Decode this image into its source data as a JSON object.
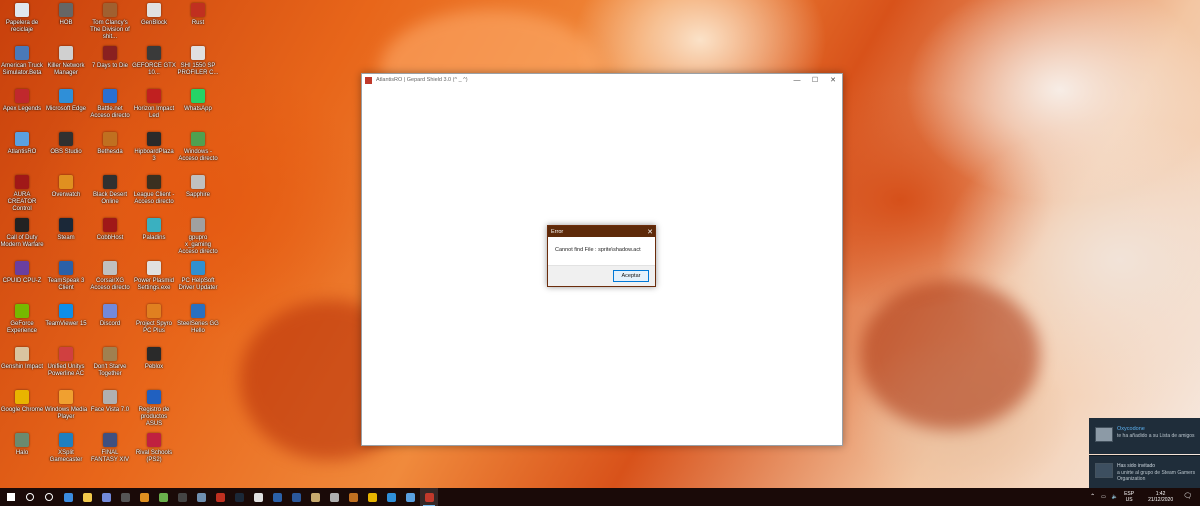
{
  "desktop_icons": [
    {
      "label": "Papelera de reciclaje",
      "color": "#dfe7ef",
      "col": 0,
      "row": 0
    },
    {
      "label": "American Truck Simulator.Beta",
      "color": "#4a79b8",
      "col": 0,
      "row": 1
    },
    {
      "label": "Apex Legends",
      "color": "#c0282d",
      "col": 0,
      "row": 2
    },
    {
      "label": "AtlantisRO",
      "color": "#5aa0e0",
      "col": 0,
      "row": 3
    },
    {
      "label": "AURA CREATOR Control",
      "color": "#a01818",
      "col": 0,
      "row": 4
    },
    {
      "label": "Call of Duty Modern Warfare",
      "color": "#222222",
      "col": 0,
      "row": 5
    },
    {
      "label": "CPUID CPU-Z",
      "color": "#6a3fa0",
      "col": 0,
      "row": 6
    },
    {
      "label": "GeForce Experience",
      "color": "#76b900",
      "col": 0,
      "row": 7
    },
    {
      "label": "Genshin Impact",
      "color": "#d9c4a0",
      "col": 0,
      "row": 8
    },
    {
      "label": "Google Chrome",
      "color": "#e8b400",
      "col": 0,
      "row": 9
    },
    {
      "label": "Halo",
      "color": "#6b8a6f",
      "col": 0,
      "row": 10
    },
    {
      "label": "HOB",
      "color": "#666666",
      "col": 1,
      "row": 0
    },
    {
      "label": "Killer Network Manager",
      "color": "#d0d0d0",
      "col": 1,
      "row": 1
    },
    {
      "label": "Microsoft Edge",
      "color": "#2f8fd8",
      "col": 1,
      "row": 2
    },
    {
      "label": "OBS Studio",
      "color": "#303030",
      "col": 1,
      "row": 3
    },
    {
      "label": "Overwatch",
      "color": "#e09020",
      "col": 1,
      "row": 4
    },
    {
      "label": "Steam",
      "color": "#1b2838",
      "col": 1,
      "row": 5
    },
    {
      "label": "TeamSpeak 3 Client",
      "color": "#2b60a8",
      "col": 1,
      "row": 6
    },
    {
      "label": "TeamViewer 15",
      "color": "#0e8ee9",
      "col": 1,
      "row": 7
    },
    {
      "label": "Unified Unitys Powerline AC",
      "color": "#d04040",
      "col": 1,
      "row": 8
    },
    {
      "label": "Windows Media Player",
      "color": "#f0a030",
      "col": 1,
      "row": 9
    },
    {
      "label": "XSplit Gamecaster",
      "color": "#1f7fc0",
      "col": 1,
      "row": 10
    },
    {
      "label": "Tom Clancy's The Division of shit...",
      "color": "#a06030",
      "col": 2,
      "row": 0
    },
    {
      "label": "7 Days to Die",
      "color": "#8a2020",
      "col": 2,
      "row": 1
    },
    {
      "label": "Battle.net Acceso directo",
      "color": "#2a6fd0",
      "col": 2,
      "row": 2
    },
    {
      "label": "Bethesda",
      "color": "#c07020",
      "col": 2,
      "row": 3
    },
    {
      "label": "Black Desert Online",
      "color": "#303030",
      "col": 2,
      "row": 4
    },
    {
      "label": "CobbHost",
      "color": "#a01818",
      "col": 2,
      "row": 5
    },
    {
      "label": "CorsairXG Acceso directo",
      "color": "#c0c0c0",
      "col": 2,
      "row": 6
    },
    {
      "label": "Discord",
      "color": "#7289da",
      "col": 2,
      "row": 7
    },
    {
      "label": "Don't Starve Together",
      "color": "#a08050",
      "col": 2,
      "row": 8
    },
    {
      "label": "Face Vista 7.0",
      "color": "#b0b0b0",
      "col": 2,
      "row": 9
    },
    {
      "label": "FINAL FANTASY XIV",
      "color": "#405080",
      "col": 2,
      "row": 10
    },
    {
      "label": "GenBlock",
      "color": "#e0e0e0",
      "col": 3,
      "row": 0
    },
    {
      "label": "GEFORCE GTX 10...",
      "color": "#3a3a3a",
      "col": 3,
      "row": 1
    },
    {
      "label": "Horizon Impact Led",
      "color": "#c02020",
      "col": 3,
      "row": 2
    },
    {
      "label": "HipboardPlaza 3",
      "color": "#2a2a2a",
      "col": 3,
      "row": 3
    },
    {
      "label": "League Client - Acceso directo",
      "color": "#3a3020",
      "col": 3,
      "row": 4
    },
    {
      "label": "Paladins",
      "color": "#3ab0c0",
      "col": 3,
      "row": 5
    },
    {
      "label": "Power Plasmid Settings.exe",
      "color": "#e0e0e0",
      "col": 3,
      "row": 6
    },
    {
      "label": "Project Spyro PC Plus",
      "color": "#e08020",
      "col": 3,
      "row": 7
    },
    {
      "label": "Peblox",
      "color": "#2a2a2a",
      "col": 3,
      "row": 8
    },
    {
      "label": "Registro de productos ASUS",
      "color": "#2060c0",
      "col": 3,
      "row": 9
    },
    {
      "label": "Rival Schools (PS2)",
      "color": "#c02040",
      "col": 3,
      "row": 10
    },
    {
      "label": "Rust",
      "color": "#c03020",
      "col": 4,
      "row": 0
    },
    {
      "label": "SHI 1550 SP PROFILER C...",
      "color": "#e0e0e0",
      "col": 4,
      "row": 1
    },
    {
      "label": "WhatsApp",
      "color": "#25d366",
      "col": 4,
      "row": 2
    },
    {
      "label": "Windows - Acceso directo",
      "color": "#50a050",
      "col": 4,
      "row": 3
    },
    {
      "label": "Sapphire",
      "color": "#c0c0c0",
      "col": 4,
      "row": 4
    },
    {
      "label": "gpupro x_gaming Acceso directo",
      "color": "#a0a0a0",
      "col": 4,
      "row": 5
    },
    {
      "label": "PC HelpSoft Driver Updater",
      "color": "#3090d0",
      "col": 4,
      "row": 6
    },
    {
      "label": "SteelSeries GG Hello",
      "color": "#2a70c0",
      "col": 4,
      "row": 7
    }
  ],
  "main_window": {
    "title": "AtlantisRO | Gepard Shield 3.0 (^ _ ^)",
    "minimize": "—",
    "maximize": "☐",
    "close": "✕"
  },
  "error_dialog": {
    "title": "Error",
    "close": "✕",
    "message": "Cannot find File : sprite\\shadow.act",
    "ok_label": "Aceptar"
  },
  "notifications": [
    {
      "title": "Oxycodone",
      "text": "te ha añadido a su Lista de amigos"
    },
    {
      "title": "Has sido invitado",
      "text": "a unirte al grupo de Steam Gamers Organization"
    }
  ],
  "taskbar": {
    "apps": [
      {
        "name": "start-icon",
        "color": "#ffffff"
      },
      {
        "name": "search-icon",
        "color": "#ffffff"
      },
      {
        "name": "task-view-icon",
        "color": "#ffffff"
      },
      {
        "name": "mail-icon",
        "color": "#3b8ce0"
      },
      {
        "name": "file-explorer-icon",
        "color": "#f2c94c"
      },
      {
        "name": "discord-icon",
        "color": "#7289da"
      },
      {
        "name": "nvidia-icon",
        "color": "#555555"
      },
      {
        "name": "overwatch-icon",
        "color": "#e09020"
      },
      {
        "name": "gear-app-icon",
        "color": "#6ab04c"
      },
      {
        "name": "obs-icon",
        "color": "#444444"
      },
      {
        "name": "calculator-icon",
        "color": "#6f8fb0"
      },
      {
        "name": "rust-icon",
        "color": "#c03020"
      },
      {
        "name": "steam-icon",
        "color": "#1b2838"
      },
      {
        "name": "cloud-icon",
        "color": "#e0e0e0"
      },
      {
        "name": "teamspeak-icon",
        "color": "#2b60a8"
      },
      {
        "name": "word-icon",
        "color": "#2b579a"
      },
      {
        "name": "league-icon",
        "color": "#c8aa6e"
      },
      {
        "name": "brush-icon",
        "color": "#b0b0b0"
      },
      {
        "name": "bethesda-icon",
        "color": "#c07020"
      },
      {
        "name": "chrome-icon",
        "color": "#e8b400"
      },
      {
        "name": "edge-icon",
        "color": "#2f8fd8"
      },
      {
        "name": "onedrive-icon",
        "color": "#5aa0e0"
      },
      {
        "name": "atlantisro-icon",
        "color": "#c0392b",
        "active": true
      }
    ],
    "language": "ESP",
    "region": "US",
    "time": "1:42",
    "date": "21/12/2020"
  }
}
